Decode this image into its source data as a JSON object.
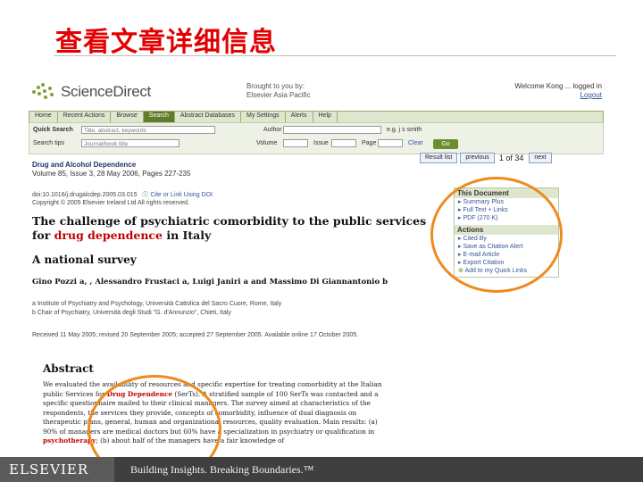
{
  "slide": {
    "title": "查看文章详细信息"
  },
  "header": {
    "logo": "ScienceDirect",
    "brought_by": [
      "Brought to you by:",
      "Elsevier Asia Pacific"
    ],
    "login": [
      "Welcome Kong ... logged in",
      "Logout"
    ]
  },
  "navbar": {
    "items": [
      "Home",
      "Recent Actions",
      "Browse",
      "Search",
      "Abstract Databases",
      "My Settings",
      "Alerts",
      "Help"
    ]
  },
  "quick_search": {
    "label": "Quick Search",
    "terms_placeholder": "Title, abstract, keywords",
    "author_label": "Author",
    "author_hint": "e.g. j s smith",
    "search_all_label": "Search tips",
    "journal_placeholder": "Journal/book title",
    "volume_label": "Volume",
    "issue_label": "Issue",
    "page_label": "Page",
    "clear_label": "Clear",
    "go_label": "Go"
  },
  "pager": {
    "results_label": "Result list",
    "previous_label": "previous",
    "count": "1 of 34",
    "next_label": "next"
  },
  "journal": {
    "name": "Drug and Alcohol Dependence",
    "issue": "Volume 85, Issue 3, 28 May 2006, Pages 227-235"
  },
  "doi": {
    "line1": "doi:10.1016/j.drugalcdep.2005.03.015",
    "cite": "Cite or Link Using DOI",
    "line2": "Copyright © 2005 Elsevier Ireland Ltd All rights reserved."
  },
  "article": {
    "title_before": "The challenge of psychiatric comorbidity to the public services for ",
    "title_hl1": "drug dependence",
    "title_after": " in Italy",
    "subtitle": "A national survey",
    "authors": "Gino Pozzi a, , Alessandro Frustaci a, Luigi Janiri a and Massimo Di Giannantonio b",
    "affil_a": "a Institute of Psychiatry and Psychology, Università Cattolica del Sacro Cuore, Rome, Italy",
    "affil_b": "b Chair of Psychiatry, Università degli Studi \"G. d'Annunzio\", Chieti, Italy",
    "received": "Received 11 May 2005; revised 20 September 2005; accepted 27 September 2005. Available online 17 October 2005."
  },
  "side_panel": {
    "this_document": "This Document",
    "doc_items": [
      "Summary Plus",
      "Full Text + Links",
      "PDF (270 K)"
    ],
    "actions": "Actions",
    "action_items": [
      "Cited By",
      "Save as Citation Alert",
      "E-mail Article",
      "Export Citation",
      "Add to my Quick Links"
    ]
  },
  "abstract": {
    "heading": "Abstract",
    "p1": "We evaluated the availability of resources and specific expertise for treating comorbidity at the Italian public Services for ",
    "hl1": "Drug Dependence",
    "p2": " (SerTs). A stratified sample of 100 SerTs was contacted and a specific questionnaire mailed to their clinical managers. The survey aimed at characteristics of the respondents, the services they provide, concepts of comorbidity, influence of dual diagnosis on therapeutic plans, general, human and organizational resources, quality evaluation. Main results: (a) 90% of managers are medical doctors but 60% have a specialization in psychiatry or qualification in ",
    "hl2": "psychotherapy",
    "p3": "; (b) about half of the managers have a fair knowledge of"
  },
  "footer": {
    "brand": "ELSEVIER",
    "tagline": "Building Insights. Breaking Boundaries.™"
  },
  "colors": {
    "title_red": "#e30000",
    "highlight_orange": "#ee8a1e",
    "nav_green": "#5f7d2c"
  }
}
